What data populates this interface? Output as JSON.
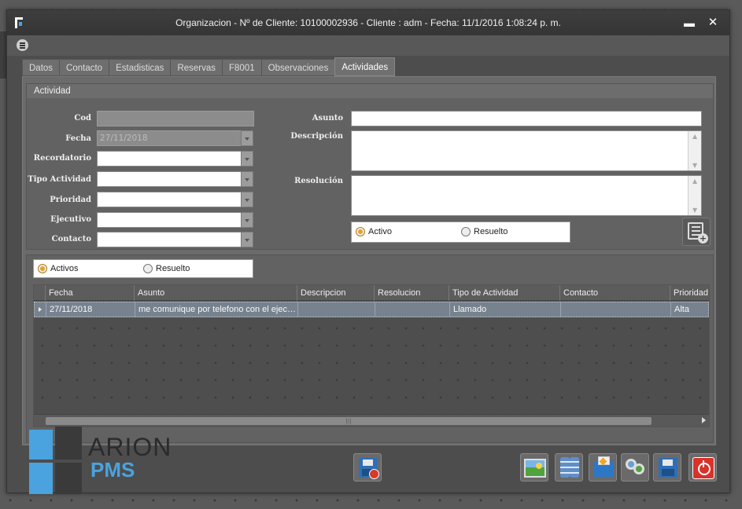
{
  "window": {
    "title": "Organizacion  - Nº de Cliente: 10100002936  - Cliente : adm  - Fecha: 11/1/2016 1:08:24 p. m.",
    "minimize": "▬",
    "close": "✕"
  },
  "tabs": [
    "Datos",
    "Contacto",
    "Estadisticas",
    "Reservas",
    "F8001",
    "Observaciones",
    "Actividades"
  ],
  "active_tab": "Actividades",
  "actividad": {
    "group_title": "Actividad",
    "labels": {
      "cod": "Cod",
      "fecha": "Fecha",
      "recordatorio": "Recordatorio",
      "tipo_actividad": "Tipo Actividad",
      "prioridad": "Prioridad",
      "ejecutivo": "Ejecutivo",
      "contacto": "Contacto",
      "asunto": "Asunto",
      "descripcion": "Descripción",
      "resolucion": "Resolución"
    },
    "values": {
      "cod": "",
      "fecha": "27/11/2018",
      "recordatorio": "",
      "tipo_actividad": "",
      "prioridad": "",
      "ejecutivo": "",
      "contacto": "",
      "asunto": "",
      "descripcion": "",
      "resolucion": ""
    },
    "status_options": [
      "Activo",
      "Resuelto"
    ],
    "status_selected": "Activo"
  },
  "filter": {
    "options": [
      "Activos",
      "Resuelto"
    ],
    "selected": "Activos"
  },
  "grid": {
    "columns": [
      "Fecha",
      "Asunto",
      "Descripcion",
      "Resolucion",
      "Tipo de Actividad",
      "Contacto",
      "Prioridad"
    ],
    "rows": [
      [
        "27/11/2018",
        "me comunique por telefono con el ejec…",
        "",
        "",
        "Llamado",
        "",
        "Alta"
      ]
    ]
  },
  "logo": {
    "brand": "ARION",
    "product": "PMS"
  },
  "colors": {
    "accent": "#4aa3df",
    "radio_on": "#e4a326",
    "selected_row": "#77828f"
  }
}
